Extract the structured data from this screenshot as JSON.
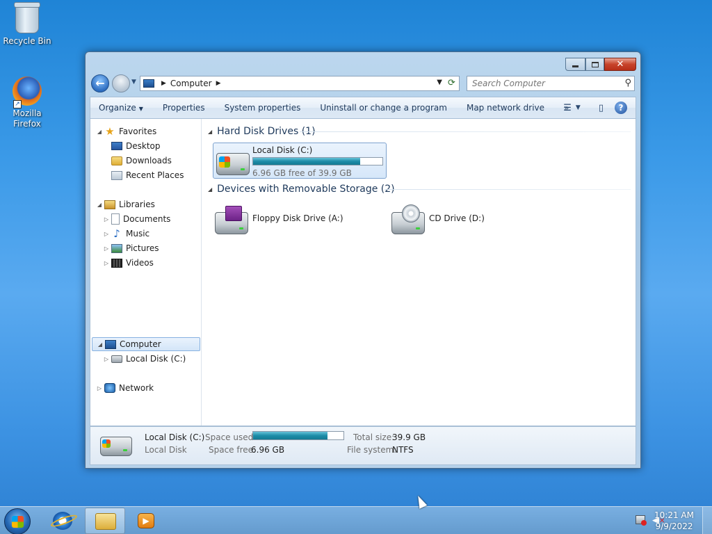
{
  "desktop": {
    "icons": [
      {
        "label": "Recycle Bin",
        "icon": "recycle-bin-icon"
      },
      {
        "label": "Mozilla Firefox",
        "icon": "firefox-icon"
      }
    ]
  },
  "window": {
    "caption_buttons": {
      "minimize": "minimize",
      "maximize": "maximize",
      "close": "✕"
    },
    "address": {
      "crumbs": [
        "Computer"
      ],
      "icon": "computer-icon"
    },
    "search": {
      "placeholder": "Search Computer"
    },
    "commands": [
      {
        "label": "Organize",
        "dropdown": true
      },
      {
        "label": "Properties"
      },
      {
        "label": "System properties"
      },
      {
        "label": "Uninstall or change a program"
      },
      {
        "label": "Map network drive"
      },
      {
        "label": "»"
      }
    ],
    "nav": {
      "favorites": {
        "label": "Favorites",
        "items": [
          "Desktop",
          "Downloads",
          "Recent Places"
        ]
      },
      "libraries": {
        "label": "Libraries",
        "items": [
          "Documents",
          "Music",
          "Pictures",
          "Videos"
        ]
      },
      "computer": {
        "label": "Computer",
        "items": [
          "Local Disk (C:)"
        ]
      },
      "network": {
        "label": "Network"
      }
    },
    "groups": {
      "hdd": {
        "title": "Hard Disk Drives (1)",
        "drive": {
          "name": "Local Disk (C:)",
          "free_text": "6.96 GB free of 39.9 GB",
          "used_fraction": 0.826
        }
      },
      "removable": {
        "title": "Devices with Removable Storage (2)",
        "devices": [
          {
            "name": "Floppy Disk Drive (A:)",
            "icon": "floppy-drive-icon"
          },
          {
            "name": "CD Drive (D:)",
            "icon": "cd-drive-icon"
          }
        ]
      }
    },
    "details": {
      "name": "Local Disk (C:)",
      "type": "Local Disk",
      "space_used_label": "Space used:",
      "space_free_label": "Space free:",
      "space_free": "6.96 GB",
      "total_size_label": "Total size:",
      "total_size": "39.9 GB",
      "file_system_label": "File system:",
      "file_system": "NTFS",
      "used_fraction": 0.826
    }
  },
  "taskbar": {
    "pinned": [
      "internet-explorer-icon",
      "windows-explorer-icon",
      "media-player-icon"
    ],
    "clock": {
      "time": "10:21 AM",
      "date": "9/9/2022"
    }
  }
}
